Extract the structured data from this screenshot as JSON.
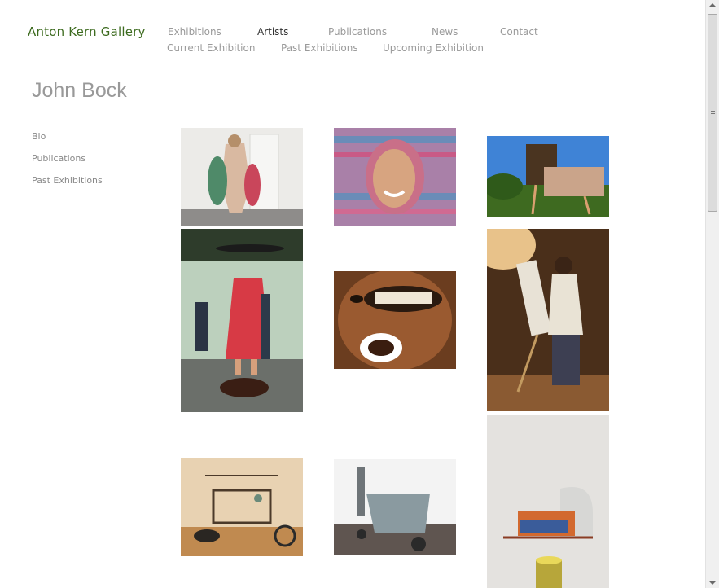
{
  "site": {
    "logo": "Anton Kern Gallery"
  },
  "nav": {
    "primary": [
      "Exhibitions",
      "Artists",
      "Publications",
      "News",
      "Contact"
    ],
    "active": "Artists",
    "secondary": [
      "Current Exhibition",
      "Past Exhibitions",
      "Upcoming Exhibition"
    ]
  },
  "artist": {
    "name": "John Bock"
  },
  "sidebar": {
    "items": [
      "Bio",
      "Publications",
      "Past Exhibitions"
    ]
  },
  "colors": {
    "logo": "#3d6b1f",
    "nav": "#9a9a9a",
    "nav_active": "#333333"
  },
  "gallery": {
    "images": [
      "artwork-image",
      "artwork-image",
      "artwork-image",
      "artwork-image",
      "artwork-image",
      "artwork-image",
      "artwork-image",
      "artwork-image",
      "artwork-image"
    ]
  }
}
